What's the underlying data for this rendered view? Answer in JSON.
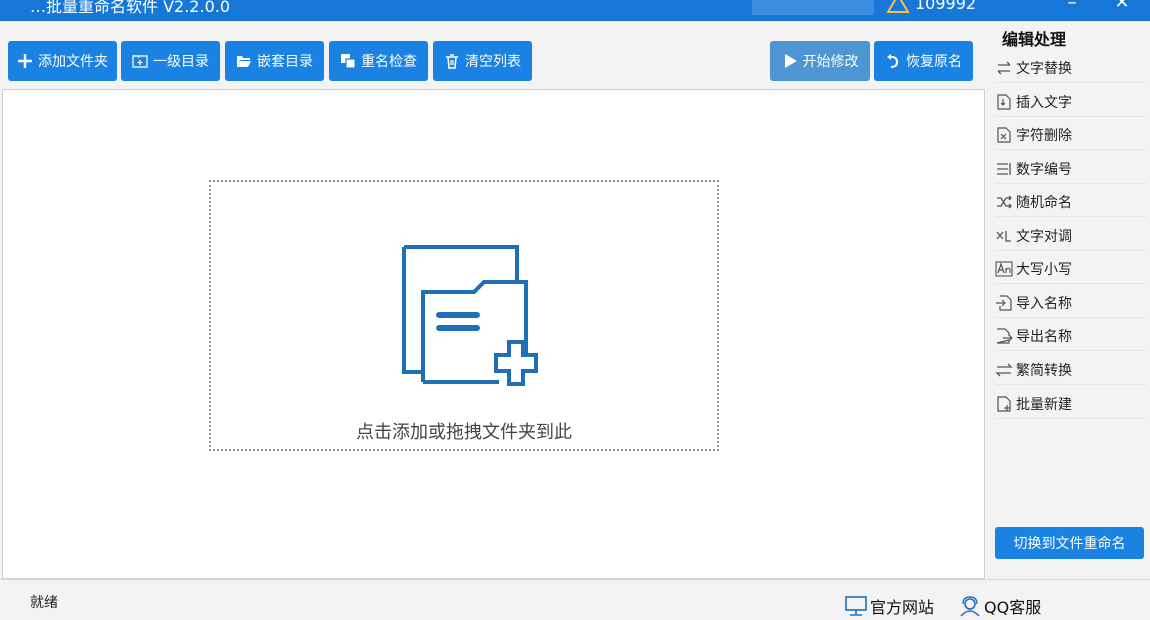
{
  "titlebar": {
    "title": "…批量重命名软件 V2.2.0.0",
    "user_id": "109992",
    "minimize": "–",
    "close": "✕"
  },
  "toolbar": {
    "add_folder": "添加文件夹",
    "level_one": "一级目录",
    "nested": "嵌套目录",
    "duplicate_check": "重名检查",
    "clear_list": "清空列表",
    "start_modify": "开始修改",
    "restore_name": "恢复原名"
  },
  "drop_zone": {
    "hint": "点击添加或拖拽文件夹到此"
  },
  "side_panel": {
    "title": "编辑处理",
    "items": [
      {
        "label": "文字替换",
        "icon": "swap-icon"
      },
      {
        "label": "插入文字",
        "icon": "insert-text-icon"
      },
      {
        "label": "字符删除",
        "icon": "delete-char-icon"
      },
      {
        "label": "数字编号",
        "icon": "numbering-icon"
      },
      {
        "label": "随机命名",
        "icon": "shuffle-icon"
      },
      {
        "label": "文字对调",
        "icon": "swap-text-icon"
      },
      {
        "label": "大写小写",
        "icon": "case-icon"
      },
      {
        "label": "导入名称",
        "icon": "import-icon"
      },
      {
        "label": "导出名称",
        "icon": "export-icon"
      },
      {
        "label": "繁简转换",
        "icon": "convert-icon"
      },
      {
        "label": "批量新建",
        "icon": "new-file-icon"
      }
    ],
    "switch_button": "切换到文件重命名"
  },
  "statusbar": {
    "status": "就绪",
    "website": "官方网站",
    "qq_support": "QQ客服"
  },
  "colors": {
    "accent": "#1a82e2",
    "accent_muted": "#4d95d3",
    "icon_blue": "#1f6fb8"
  }
}
